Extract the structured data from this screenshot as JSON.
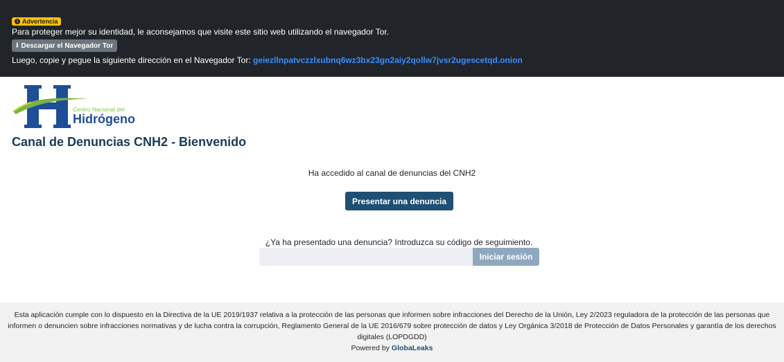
{
  "tor_banner": {
    "badge_label": "Advertencia",
    "message": "Para proteger mejor su identidad, le aconsejamos que visite este sitio web utilizando el navegador Tor.",
    "download_button": "Descargar el Navegador Tor",
    "copy_text": "Luego, copie y pegue la siguiente dirección en el Navegador Tor:",
    "onion_address": "geiezllnpatvczzlxubnq6wz3bx23gn2aiy2qollw7jvsr2ugescetqd.onion",
    "link_color": "#3d8bfd"
  },
  "logo": {
    "small_text": "Centro Nacional del",
    "big_text": "Hidrógeno"
  },
  "page_title": "Canal de Denuncias CNH2 - Bienvenido",
  "main": {
    "intro_text": "Ha accedido al canal de denuncias del CNH2",
    "submit_button": "Presentar una denuncia",
    "question_text": "¿Ya ha presentado una denuncia? Introduzca su código de seguimiento.",
    "receipt_input_value": "",
    "login_button": "Iniciar sesión"
  },
  "footer": {
    "legal_text": "Esta aplicación cumple con lo dispuesto en la Directiva de la UE 2019/1937 relativa a la protección de las personas que informen sobre infracciones del Derecho de la Unión, Ley 2/2023 reguladora de la protección de las personas que informen o denuncien sobre infracciones normativas y de lucha contra la corrupción, Reglamento General de la UE 2016/679 sobre protección de datos y Ley Orgánica 3/2018 de Protección de Datos Personales y garantía de los derechos digitales (LOPDGDD)",
    "powered_by": "Powered by",
    "powered_by_link": "GlobaLeaks"
  },
  "colors": {
    "banner_bg": "#212529",
    "primary_button": "#1f4f74",
    "login_button": "#8fa8c0",
    "title": "#1b3a5c"
  }
}
